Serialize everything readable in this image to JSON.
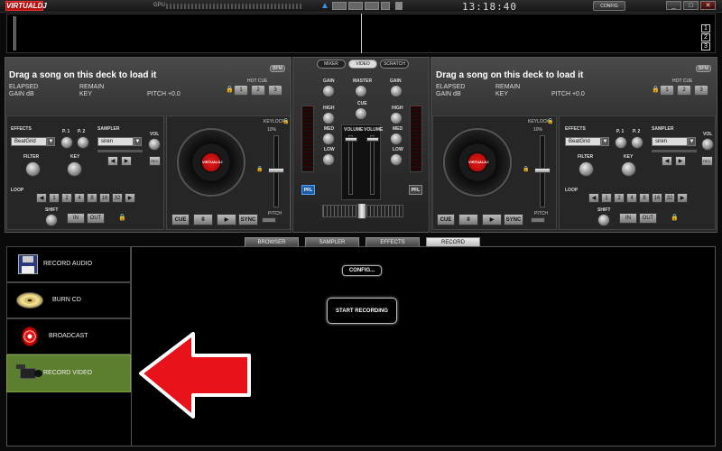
{
  "app": {
    "logo_text": "VIRTUALDJ",
    "gpu_label": "GPU",
    "clock": "13:18:40",
    "config_label": "CONFIG",
    "accent": "#b3100f"
  },
  "window_controls": {
    "minimize": "_",
    "maximize": "□",
    "close": "✕"
  },
  "waveform": {
    "slots": [
      "1",
      "2",
      "3"
    ]
  },
  "deck_left": {
    "title": "Drag a song on this deck to load it",
    "bpm_label": "BPM",
    "elapsed": "ELAPSED",
    "remain": "REMAIN",
    "gain": "GAIN dB",
    "key": "KEY",
    "pitch": "PITCH +0.0",
    "hot_cue_label": "HOT CUE",
    "hot_cues": [
      "1",
      "2",
      "3"
    ],
    "effects_label": "EFFECTS",
    "effect_value": "BeatGrid",
    "p1": "P. 1",
    "p2": "P. 2",
    "filter_label": "FILTER",
    "key_label": "KEY",
    "sampler_label": "SAMPLER",
    "sampler_value": "siren",
    "vol_label": "VOL",
    "rec_label": "REC",
    "loop_label": "LOOP",
    "loop_sizes": [
      "1",
      "2",
      "4",
      "8",
      "16",
      "32"
    ],
    "shift_label": "SHIFT",
    "in_label": "IN",
    "out_label": "OUT",
    "keylock_label": "KEYLOCK",
    "pitch_range": "10%",
    "pitch_label": "PITCH",
    "transport": {
      "cue": "CUE",
      "pause": "II",
      "play": "▶",
      "sync": "SYNC"
    },
    "jog_label": "VIRTUALDJ"
  },
  "deck_right": {
    "title": "Drag a song on this deck to load it",
    "bpm_label": "BPM",
    "elapsed": "ELAPSED",
    "remain": "REMAIN",
    "gain": "GAIN dB",
    "key": "KEY",
    "pitch": "PITCH +0.0",
    "hot_cue_label": "HOT CUE",
    "hot_cues": [
      "1",
      "2",
      "3"
    ],
    "effects_label": "EFFECTS",
    "effect_value": "BeatGrid",
    "p1": "P. 1",
    "p2": "P. 2",
    "filter_label": "FILTER",
    "key_label": "KEY",
    "sampler_label": "SAMPLER",
    "sampler_value": "siren",
    "vol_label": "VOL",
    "rec_label": "REC",
    "loop_label": "LOOP",
    "loop_sizes": [
      "1",
      "2",
      "4",
      "8",
      "16",
      "32"
    ],
    "shift_label": "SHIFT",
    "in_label": "IN",
    "out_label": "OUT",
    "keylock_label": "KEYLOCK",
    "pitch_range": "10%",
    "pitch_label": "PITCH",
    "transport": {
      "cue": "CUE",
      "pause": "II",
      "play": "▶",
      "sync": "SYNC"
    },
    "jog_label": "VIRTUALDJ"
  },
  "mixer": {
    "tabs": [
      "MIXER",
      "VIDEO",
      "SCRATCH"
    ],
    "gain": "GAIN",
    "master": "MASTER",
    "cue": "CUE",
    "high": "HIGH",
    "med": "MED",
    "low": "LOW",
    "volume": "VOLUME",
    "pfl": "PFL"
  },
  "bottom_tabs": [
    "BROWSER",
    "SAMPLER",
    "EFFECTS",
    "RECORD"
  ],
  "record": {
    "items": [
      {
        "label": "RECORD AUDIO",
        "icon": "floppy-disk-icon"
      },
      {
        "label": "BURN CD",
        "icon": "cd-disc-icon"
      },
      {
        "label": "BROADCAST",
        "icon": "broadcast-icon"
      },
      {
        "label": "RECORD VIDEO",
        "icon": "video-camera-icon"
      }
    ],
    "config_button": "CONFIG...",
    "start_button": "START RECORDING",
    "active_color": "#5b7f2e",
    "arrow_color": "#e8131a"
  }
}
